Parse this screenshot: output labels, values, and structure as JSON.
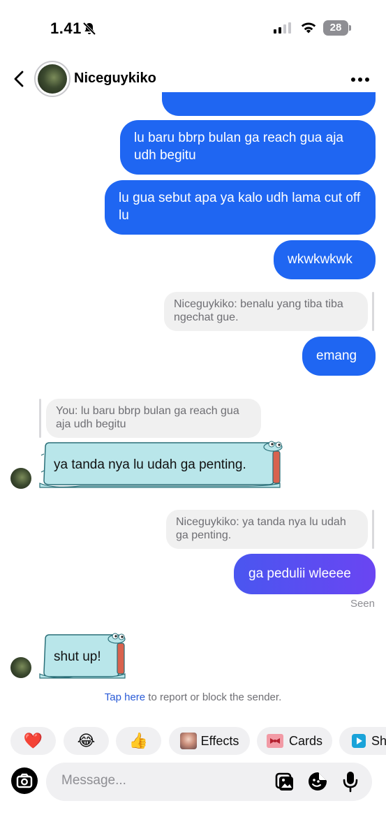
{
  "status_bar": {
    "time": "1.41",
    "battery": "28"
  },
  "header": {
    "contact_name": "Niceguykiko"
  },
  "messages": {
    "m1": "lu baru bbrp bulan ga reach gua aja udh begitu",
    "m2": "lu gua sebut apa ya kalo udh lama cut off lu",
    "m3": "wkwkwkwk",
    "reply1": "Niceguykiko: benalu yang tiba tiba ngechat gue.",
    "m4": "emang",
    "reply2": "You: lu baru bbrp bulan ga reach gua aja udh begitu",
    "m5": "ya tanda nya lu udah ga penting.",
    "reply3": "Niceguykiko: ya tanda nya lu udah ga penting.",
    "m6": "ga pedulii wleeee",
    "seen": "Seen",
    "m7": "shut up!"
  },
  "report_notice": {
    "link": "Tap here",
    "text": " to report or block the sender."
  },
  "quick_replies": {
    "heart": "❤️",
    "laugh": "😂",
    "thumbs": "👍",
    "effects": "Effects",
    "cards": "Cards",
    "share": "Sh"
  },
  "composer": {
    "placeholder": "Message..."
  },
  "colors": {
    "outgoing": "#1f66f2",
    "incoming_sticker": "#b9e6ea",
    "link": "#2a5bd7"
  }
}
